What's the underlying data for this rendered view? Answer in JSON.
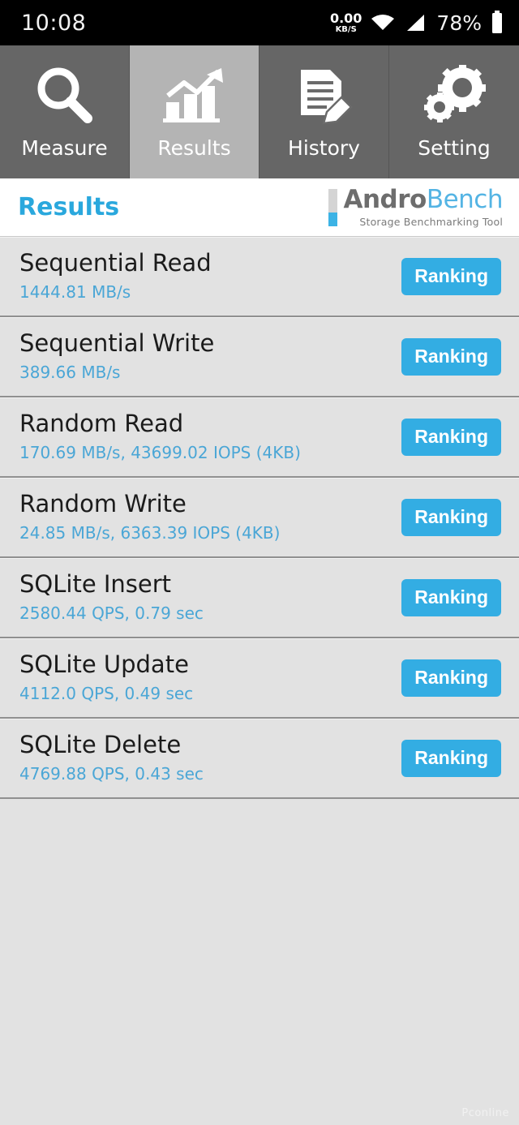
{
  "statusbar": {
    "time": "10:08",
    "net_rate": "0.00",
    "net_unit": "KB/S",
    "wifi_icon": "wifi-icon",
    "signal_icon": "cellular-signal-icon",
    "battery_percent": "78%",
    "battery_icon": "battery-icon"
  },
  "tabs": [
    {
      "label": "Measure",
      "icon": "magnifier-icon",
      "active": false
    },
    {
      "label": "Results",
      "icon": "bar-chart-arrow-icon",
      "active": true
    },
    {
      "label": "History",
      "icon": "document-pencil-icon",
      "active": false
    },
    {
      "label": "Setting",
      "icon": "gears-icon",
      "active": false
    }
  ],
  "header": {
    "title": "Results",
    "logo_andro": "Andro",
    "logo_bench": "Bench",
    "logo_subtitle": "Storage Benchmarking Tool"
  },
  "results": [
    {
      "title": "Sequential Read",
      "value": "1444.81 MB/s",
      "button": "Ranking"
    },
    {
      "title": "Sequential Write",
      "value": "389.66 MB/s",
      "button": "Ranking"
    },
    {
      "title": "Random Read",
      "value": "170.69 MB/s, 43699.02 IOPS (4KB)",
      "button": "Ranking"
    },
    {
      "title": "Random Write",
      "value": "24.85 MB/s, 6363.39 IOPS (4KB)",
      "button": "Ranking"
    },
    {
      "title": "SQLite Insert",
      "value": "2580.44 QPS, 0.79 sec",
      "button": "Ranking"
    },
    {
      "title": "SQLite Update",
      "value": "4112.0 QPS, 0.49 sec",
      "button": "Ranking"
    },
    {
      "title": "SQLite Delete",
      "value": "4769.88 QPS, 0.43 sec",
      "button": "Ranking"
    }
  ],
  "watermark": {
    "text": "Pconline",
    "sub": ""
  },
  "colors": {
    "accent_blue": "#33ade3",
    "title_blue": "#2aa8dd",
    "value_blue": "#4aa6d6",
    "list_bg": "#e2e2e2",
    "tab_inactive": "#666666",
    "tab_active": "#b4b4b4",
    "statusbar_bg": "#000000"
  }
}
